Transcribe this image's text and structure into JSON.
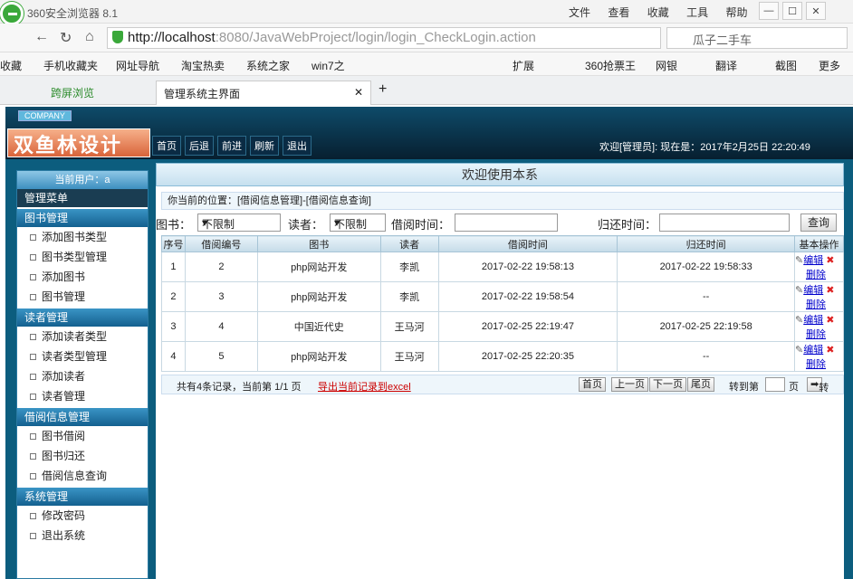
{
  "browser": {
    "title": "360安全浏览器 8.1",
    "menus": [
      "文件",
      "查看",
      "收藏",
      "工具",
      "帮助"
    ],
    "url_host": "http://localhost",
    "url_rest": ":8080/JavaWebProject/login/login_CheckLogin.action",
    "search": "瓜子二手车",
    "bookmarks": [
      "收藏",
      "手机收藏夹",
      "网址导航",
      "淘宝热卖",
      "系统之家",
      "win7之"
    ],
    "toolbar_right": [
      "扩展",
      "360抢票王",
      "网银",
      "翻译",
      "截图",
      "更多"
    ],
    "tabs": [
      "跨屏浏览",
      "管理系统主界面"
    ]
  },
  "app": {
    "company": "COMPANY",
    "brand": "双鱼林设计",
    "topnav": [
      "首页",
      "后退",
      "前进",
      "刷新",
      "退出"
    ],
    "welcome": "欢迎[管理员]:   现在是：2017年2月25日 22:20:49",
    "current_user": "当前用户：a",
    "menu_title": "管理菜单",
    "groups": [
      {
        "label": "图书管理",
        "items": [
          "添加图书类型",
          "图书类型管理",
          "添加图书",
          "图书管理"
        ]
      },
      {
        "label": "读者管理",
        "items": [
          "添加读者类型",
          "读者类型管理",
          "添加读者",
          "读者管理"
        ]
      },
      {
        "label": "借阅信息管理",
        "items": [
          "图书借阅",
          "图书归还",
          "借阅信息查询"
        ]
      },
      {
        "label": "系统管理",
        "items": [
          "修改密码",
          "退出系统"
        ]
      }
    ],
    "main_title": "欢迎使用本系",
    "location": "你当前的位置：[借阅信息管理]-[借阅信息查询]",
    "filters": {
      "book_label": "图书：",
      "book_value": "不限制",
      "reader_label": "读者：",
      "reader_value": "不限制",
      "borrow_label": "借阅时间：",
      "return_label": "归还时间：",
      "query": "查询"
    },
    "columns": [
      "序号",
      "借阅编号",
      "图书",
      "读者",
      "借阅时间",
      "归还时间",
      "基本操作"
    ],
    "rows": [
      [
        "1",
        "2",
        "php网站开发",
        "李凯",
        "2017-02-22 19:58:13",
        "2017-02-22 19:58:33"
      ],
      [
        "2",
        "3",
        "php网站开发",
        "李凯",
        "2017-02-22 19:58:54",
        "--"
      ],
      [
        "3",
        "4",
        "中国近代史",
        "王马河",
        "2017-02-25 22:19:47",
        "2017-02-25 22:19:58"
      ],
      [
        "4",
        "5",
        "php网站开发",
        "王马河",
        "2017-02-25 22:20:35",
        "--"
      ]
    ],
    "ops": {
      "edit": "编辑",
      "delete": "删除"
    },
    "pager": {
      "info": "共有4条记录，当前第 1/1 页",
      "export": "导出当前记录到excel",
      "first": "首页",
      "prev": "上一页",
      "next": "下一页",
      "last": "尾页",
      "goto": "转到第",
      "page": "页",
      "go": "转"
    }
  }
}
